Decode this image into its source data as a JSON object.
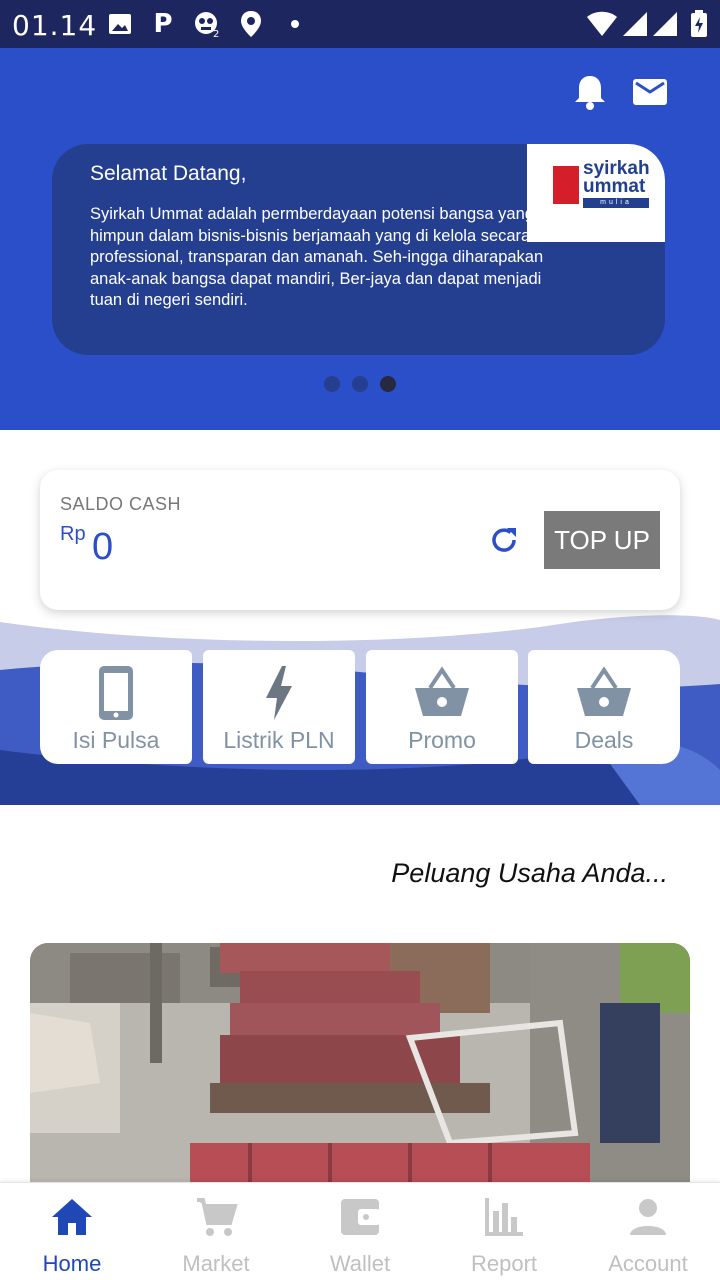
{
  "status_bar": {
    "time": "01.14",
    "p_label": "P",
    "icons": [
      "photo-icon",
      "parking-p-icon",
      "game-icon",
      "location-pin-icon",
      "notification-dot-icon",
      "wifi-icon",
      "signal-icon",
      "signal-icon",
      "battery-charging-icon"
    ]
  },
  "header": {
    "icons": [
      "bell-icon",
      "mail-icon"
    ],
    "accent_color": "#2b4fc8",
    "card_color": "#243f8f"
  },
  "carousel": {
    "slides_count": 3,
    "active_index": 2,
    "slide": {
      "title": "Selamat Datang,",
      "body": "Syirkah Ummat adalah permberdayaan potensi bangsa yang di himpun dalam bisnis-bisnis berjamaah yang di kelola secara professional, transparan dan amanah. Seh-ingga diharapakan anak-anak bangsa dapat mandiri, Ber-jaya dan dapat menjadi tuan di negeri sendiri.",
      "logo": {
        "line1": "syirkah",
        "line2": "ummat",
        "line3": "mulia"
      }
    }
  },
  "saldo": {
    "label": "SALDO CASH",
    "currency": "Rp",
    "amount": "0",
    "topup_label": "TOP UP"
  },
  "menu": [
    {
      "label": "Isi Pulsa",
      "icon": "phone-icon"
    },
    {
      "label": "Listrik PLN",
      "icon": "lightning-icon"
    },
    {
      "label": "Promo",
      "icon": "basket-icon"
    },
    {
      "label": "Deals",
      "icon": "basket-icon"
    }
  ],
  "section": {
    "title": "Peluang Usaha Anda..."
  },
  "bottom_nav": {
    "active": "Home",
    "active_color": "#1f47b5",
    "items": [
      {
        "label": "Home",
        "icon": "home-icon"
      },
      {
        "label": "Market",
        "icon": "cart-icon"
      },
      {
        "label": "Wallet",
        "icon": "wallet-icon"
      },
      {
        "label": "Report",
        "icon": "bar-chart-icon"
      },
      {
        "label": "Account",
        "icon": "person-icon"
      }
    ]
  }
}
